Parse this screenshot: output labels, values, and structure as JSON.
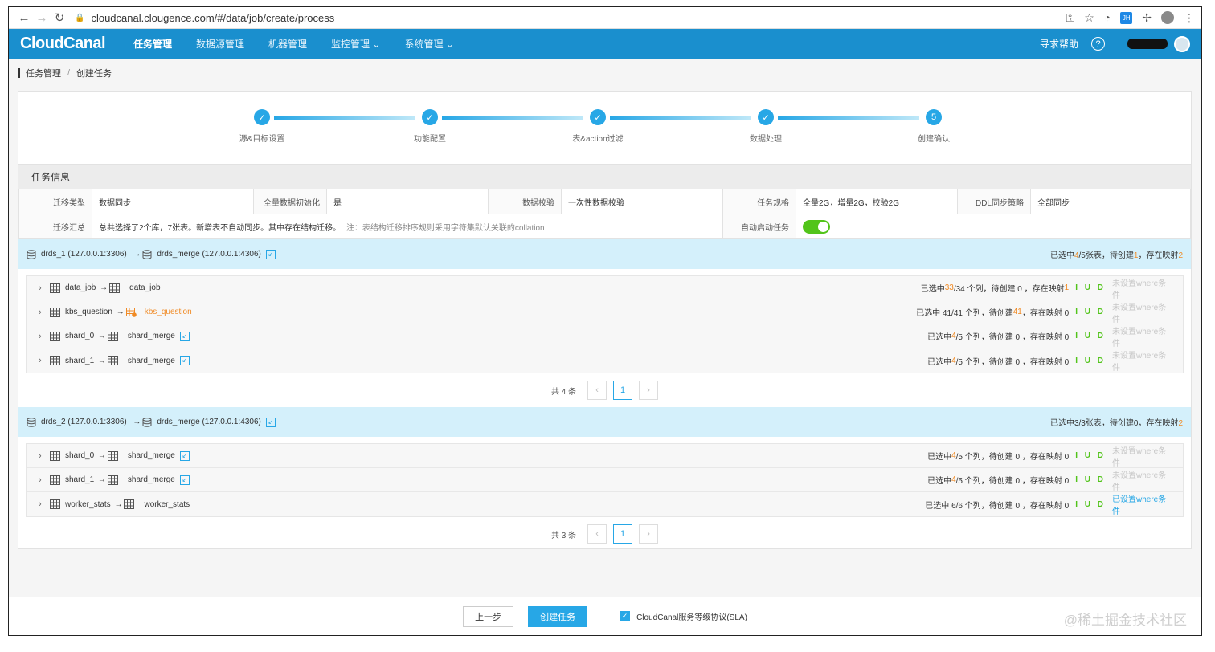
{
  "browser": {
    "url": "cloudcanal.clougence.com/#/data/job/create/process",
    "ext_badge": "JH"
  },
  "nav": {
    "logo": "CloudCanal",
    "items": [
      "任务管理",
      "数据源管理",
      "机器管理",
      "监控管理",
      "系统管理"
    ],
    "help": "寻求帮助",
    "help_icon": "?"
  },
  "breadcrumb": [
    "任务管理",
    "创建任务"
  ],
  "steps": [
    {
      "label": "源&目标设置",
      "mark": "✓"
    },
    {
      "label": "功能配置",
      "mark": "✓"
    },
    {
      "label": "表&action过滤",
      "mark": "✓"
    },
    {
      "label": "数据处理",
      "mark": "✓"
    },
    {
      "label": "创建确认",
      "mark": "5"
    }
  ],
  "task_info": {
    "title": "任务信息",
    "row1": [
      {
        "k": "迁移类型",
        "v": "数据同步"
      },
      {
        "k": "全量数据初始化",
        "v": "是"
      },
      {
        "k": "数据校验",
        "v": "一次性数据校验"
      },
      {
        "k": "任务规格",
        "v": "全量2G，增量2G，校验2G"
      },
      {
        "k": "DDL同步策略",
        "v": "全部同步"
      }
    ],
    "summary_k": "迁移汇总",
    "summary_v": "总共选择了2个库，7张表。新增表不自动同步。其中存在结构迁移。",
    "summary_hint": "注：表结构迁移排序规则采用字符集默认关联的collation",
    "auto_k": "自动启动任务"
  },
  "groups": [
    {
      "src": "drds_1",
      "src_addr": "(127.0.0.1:3306)",
      "dst": "drds_merge",
      "dst_addr": "(127.0.0.1:4306)",
      "summary": [
        "已选中",
        "4",
        "/5张表，待创建",
        "1",
        "，存在映射",
        "2"
      ],
      "rows": [
        {
          "src": "data_job",
          "dst": "data_job",
          "dst_orange": false,
          "link": false,
          "stat": [
            "已选中 ",
            "33",
            "/34 个列，待创建 0 ，存在映射 ",
            "1",
            ""
          ],
          "iud": "I U D",
          "where": "未设置where条件",
          "where_set": false
        },
        {
          "src": "kbs_question",
          "dst": "kbs_question",
          "dst_orange": true,
          "link": false,
          "stat": [
            "已选中 41/41 个列，待创建 ",
            "41",
            "，存在映射 0",
            "",
            ""
          ],
          "iud": "I U D",
          "where": "未设置where条件",
          "where_set": false
        },
        {
          "src": "shard_0",
          "dst": "shard_merge",
          "dst_orange": false,
          "link": true,
          "stat": [
            "已选中 ",
            "4",
            "/5 个列，待创建 0 ，存在映射 0",
            "",
            ""
          ],
          "iud": "I U D",
          "where": "未设置where条件",
          "where_set": false
        },
        {
          "src": "shard_1",
          "dst": "shard_merge",
          "dst_orange": false,
          "link": true,
          "stat": [
            "已选中 ",
            "4",
            "/5 个列，待创建 0 ，存在映射 0",
            "",
            ""
          ],
          "iud": "I U D",
          "where": "未设置where条件",
          "where_set": false
        }
      ],
      "pager": {
        "total": "共 4 条",
        "page": "1"
      }
    },
    {
      "src": "drds_2",
      "src_addr": "(127.0.0.1:3306)",
      "dst": "drds_merge",
      "dst_addr": "(127.0.0.1:4306)",
      "summary": [
        "已选中3/3张表，待创建0，存在映射",
        "2",
        "",
        "",
        "",
        ""
      ],
      "rows": [
        {
          "src": "shard_0",
          "dst": "shard_merge",
          "dst_orange": false,
          "link": true,
          "stat": [
            "已选中 ",
            "4",
            "/5 个列，待创建 0 ，存在映射 0",
            "",
            ""
          ],
          "iud": "I U D",
          "where": "未设置where条件",
          "where_set": false
        },
        {
          "src": "shard_1",
          "dst": "shard_merge",
          "dst_orange": false,
          "link": true,
          "stat": [
            "已选中 ",
            "4",
            "/5 个列，待创建 0 ，存在映射 0",
            "",
            ""
          ],
          "iud": "I U D",
          "where": "未设置where条件",
          "where_set": false
        },
        {
          "src": "worker_stats",
          "dst": "worker_stats",
          "dst_orange": false,
          "link": false,
          "stat": [
            "已选中 6/6 个列，待创建 0 ，存在映射 0",
            "",
            "",
            "",
            ""
          ],
          "iud": "I U D",
          "where": "已设置where条件",
          "where_set": true
        }
      ],
      "pager": {
        "total": "共 3 条",
        "page": "1"
      }
    }
  ],
  "footer": {
    "prev": "上一步",
    "create": "创建任务",
    "sla": "CloudCanal服务等级协议(SLA)"
  },
  "watermark": "@稀土掘金技术社区",
  "colors": {
    "primary": "#27a7e6",
    "nav": "#1a8fce",
    "success": "#52c41a",
    "orange": "#f08a24",
    "group_bg": "#d4f0fb"
  }
}
